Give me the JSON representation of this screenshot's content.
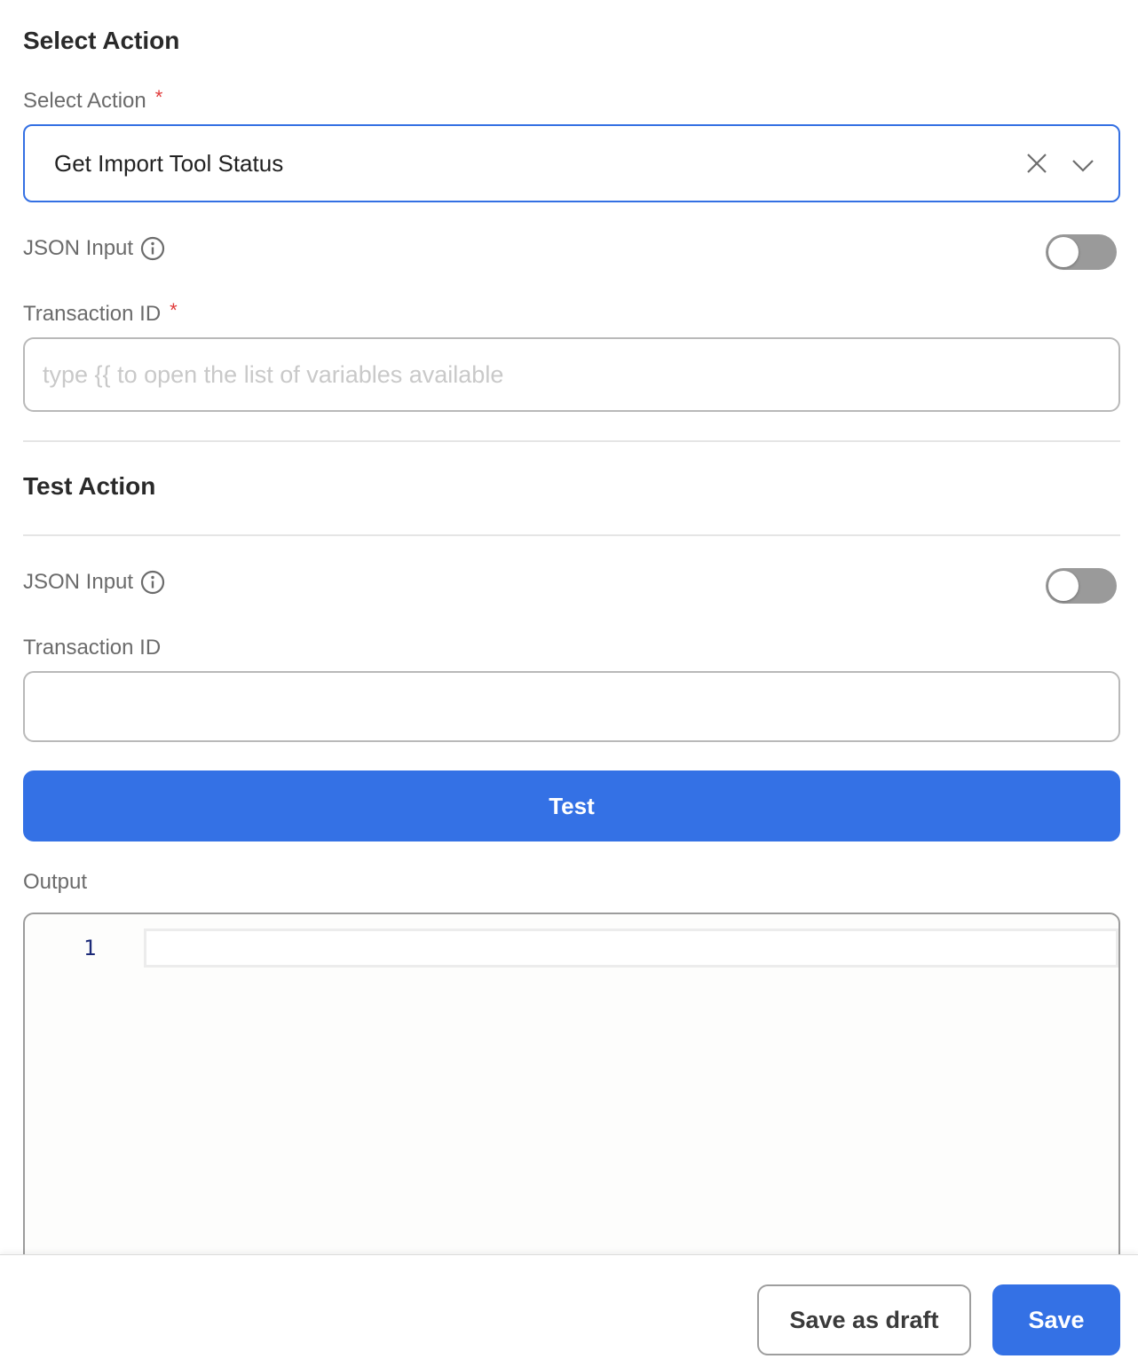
{
  "select_section": {
    "title": "Select Action",
    "action_label": "Select Action",
    "required_mark": "*",
    "action_value": "Get Import Tool Status",
    "json_input_label": "JSON Input",
    "json_input_enabled": false,
    "transaction_label": "Transaction ID",
    "transaction_placeholder": "type {{ to open the list of variables available",
    "transaction_value": ""
  },
  "test_section": {
    "title": "Test Action",
    "json_input_label": "JSON Input",
    "json_input_enabled": false,
    "transaction_label": "Transaction ID",
    "transaction_value": "",
    "test_button": "Test",
    "output_label": "Output",
    "output_line_numbers": [
      "1"
    ]
  },
  "footer": {
    "draft_button": "Save as draft",
    "save_button": "Save"
  },
  "colors": {
    "accent": "#3471e5",
    "required": "#e03a3a",
    "toggle_off": "#9a9a9a"
  },
  "icons": [
    "close-icon",
    "chevron-down-icon",
    "info-icon"
  ]
}
